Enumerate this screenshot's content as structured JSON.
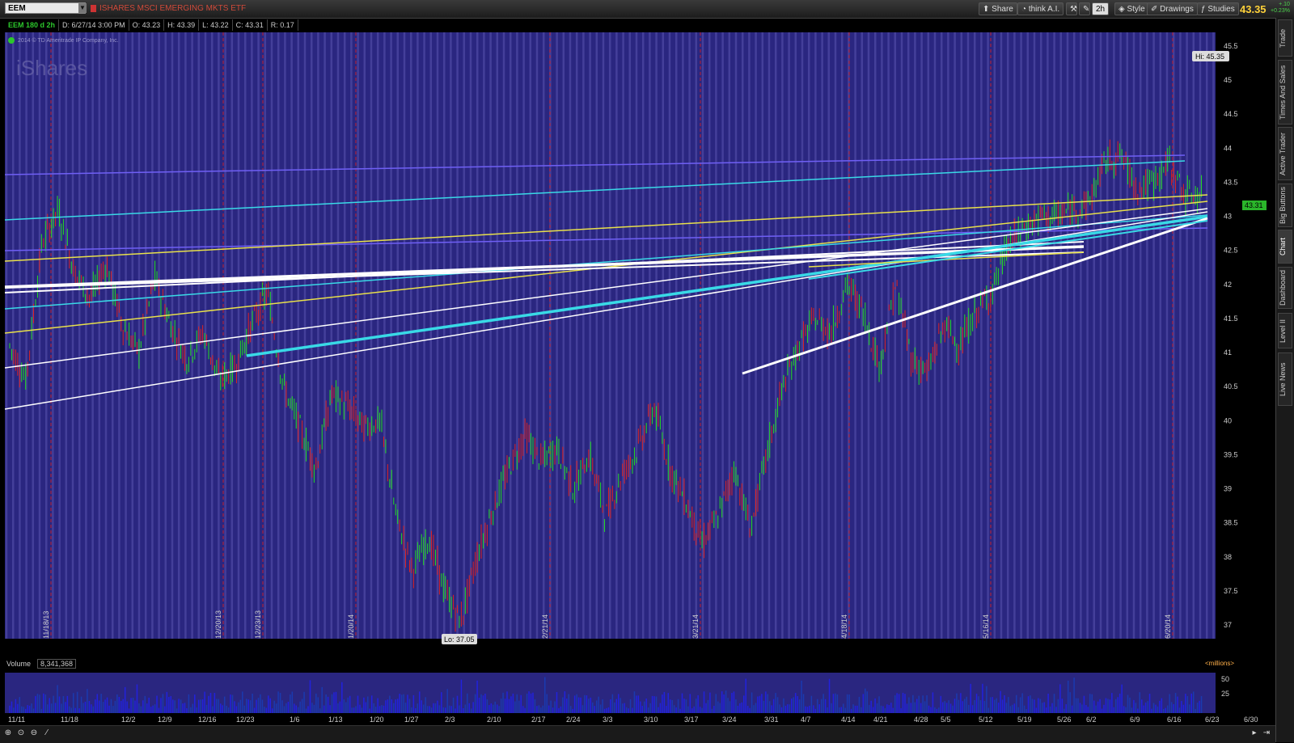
{
  "header": {
    "symbol": "EEM",
    "title": "ISHARES MSCI EMERGING MKTS ETF",
    "buttons": {
      "share": "Share",
      "think": "think A.I.",
      "timeframe": "2h",
      "style": "Style",
      "drawings": "Drawings",
      "studies": "Studies"
    },
    "last_price": "43.35",
    "change": "+.10",
    "change_pct": "+0.23%"
  },
  "infobar": {
    "study": "EEM 180 d 2h",
    "date": "D: 6/27/14 3:00 PM",
    "open": "O: 43.23",
    "high": "H: 43.39",
    "low": "L: 43.22",
    "close": "C: 43.31",
    "range": "R: 0.17"
  },
  "chart": {
    "copyright": "2014 © TD Ameritrade IP Company, Inc.",
    "watermark": "iShares",
    "hi_label": "Hi: 45.35",
    "lo_label": "Lo: 37.05",
    "current_price_tag": "43.31",
    "bg_color": "#2a2680",
    "colors": {
      "up": "#22dd22",
      "down": "#dd2222",
      "white": "#ffffff",
      "cyan": "#39d9e6",
      "yellow": "#e8e04a",
      "violet": "#6f5ff5"
    }
  },
  "volume": {
    "label": "Volume",
    "value": "8,341,368",
    "units": "<millions>"
  },
  "right_tabs": [
    "Trade",
    "Times And Sales",
    "Active Trader",
    "Big Buttons",
    "Chart",
    "Dashboard",
    "Level II",
    "Live News"
  ],
  "chart_data": {
    "type": "candlestick",
    "y_ticks": [
      "45.5",
      "45",
      "44.5",
      "44",
      "43.5",
      "43",
      "42.5",
      "42",
      "41.5",
      "41",
      "40.5",
      "40",
      "39.5",
      "39",
      "38.5",
      "38",
      "37.5",
      "37"
    ],
    "ylim": [
      36.8,
      45.7
    ],
    "x_ticks": [
      "11/11",
      "11/18",
      "12/2",
      "12/9",
      "12/16",
      "12/23",
      "1/6",
      "1/13",
      "1/20",
      "1/27",
      "2/3",
      "2/10",
      "2/17",
      "2/24",
      "3/3",
      "3/10",
      "3/17",
      "3/24",
      "3/31",
      "4/7",
      "4/14",
      "4/21",
      "4/28",
      "5/5",
      "5/12",
      "5/19",
      "5/26",
      "6/2",
      "6/9",
      "6/16",
      "6/23",
      "6/30"
    ],
    "month_markers": [
      "11/18/13",
      "12/20/13",
      "12/23/13",
      "1/20/14",
      "2/21/14",
      "3/21/14",
      "4/18/14",
      "5/16/14",
      "6/20/14"
    ],
    "price_path": [
      41.1,
      40.6,
      42.6,
      43.1,
      42.2,
      41.8,
      42.3,
      41.4,
      41.0,
      42.1,
      41.4,
      40.9,
      41.3,
      40.6,
      40.8,
      41.4,
      41.9,
      40.5,
      39.9,
      39.3,
      40.4,
      40.2,
      39.9,
      40.0,
      38.6,
      37.8,
      38.3,
      37.5,
      37.05,
      38.0,
      38.7,
      39.3,
      39.8,
      39.4,
      39.6,
      39.0,
      39.5,
      38.6,
      39.2,
      39.6,
      40.2,
      39.3,
      38.8,
      38.2,
      38.6,
      39.3,
      38.4,
      39.5,
      40.5,
      41.1,
      41.5,
      41.3,
      42.0,
      41.6,
      40.8,
      42.0,
      40.9,
      40.7,
      41.4,
      41.1,
      41.6,
      41.9,
      42.6,
      42.8,
      43.0,
      43.0,
      43.1,
      43.2,
      43.8,
      43.9,
      43.4,
      43.5,
      43.8,
      43.3,
      43.31
    ],
    "volume_y_ticks": [
      "50",
      "25"
    ],
    "hi": 45.35,
    "lo": 37.05
  }
}
